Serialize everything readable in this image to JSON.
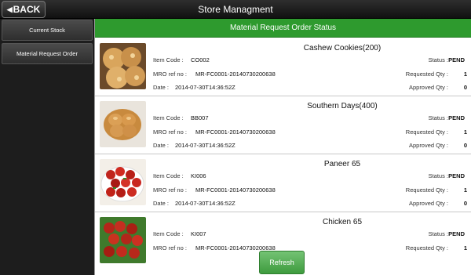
{
  "header": {
    "back_label": "BACK",
    "title": "Store Managment"
  },
  "sidebar": {
    "items": [
      {
        "label": "Current Stock"
      },
      {
        "label": "Material Request Order"
      }
    ]
  },
  "panel": {
    "title": "Material Request Order Status"
  },
  "labels": {
    "item_code": "Item Code :",
    "mro_ref": "MRO ref no :",
    "date": "Date :",
    "status": "Status :",
    "requested_qty": "Requested Qty :",
    "approved_qty": "Approved Qty :"
  },
  "orders": [
    {
      "name": "Cashew Cookies(200)",
      "item_code": "CO002",
      "mro_ref": "MR-FC0001-20140730200638",
      "date": "2014-07-30T14:36:52Z",
      "status": "PEND",
      "requested_qty": "1",
      "approved_qty": "0"
    },
    {
      "name": "Southern Days(400)",
      "item_code": "BB007",
      "mro_ref": "MR-FC0001-20140730200638",
      "date": "2014-07-30T14:36:52Z",
      "status": "PEND",
      "requested_qty": "1",
      "approved_qty": "0"
    },
    {
      "name": "Paneer 65",
      "item_code": "KI006",
      "mro_ref": "MR-FC0001-20140730200638",
      "date": "2014-07-30T14:36:52Z",
      "status": "PEND",
      "requested_qty": "1",
      "approved_qty": "0"
    },
    {
      "name": "Chicken 65",
      "item_code": "KI007",
      "mro_ref": "MR-FC0001-20140730200638",
      "date": "",
      "status": "PEND",
      "requested_qty": "1",
      "approved_qty": ""
    }
  ],
  "footer": {
    "refresh_label": "Refresh"
  },
  "colors": {
    "accent_green": "#2e9a2e",
    "topbar": "#1a1a1a"
  }
}
